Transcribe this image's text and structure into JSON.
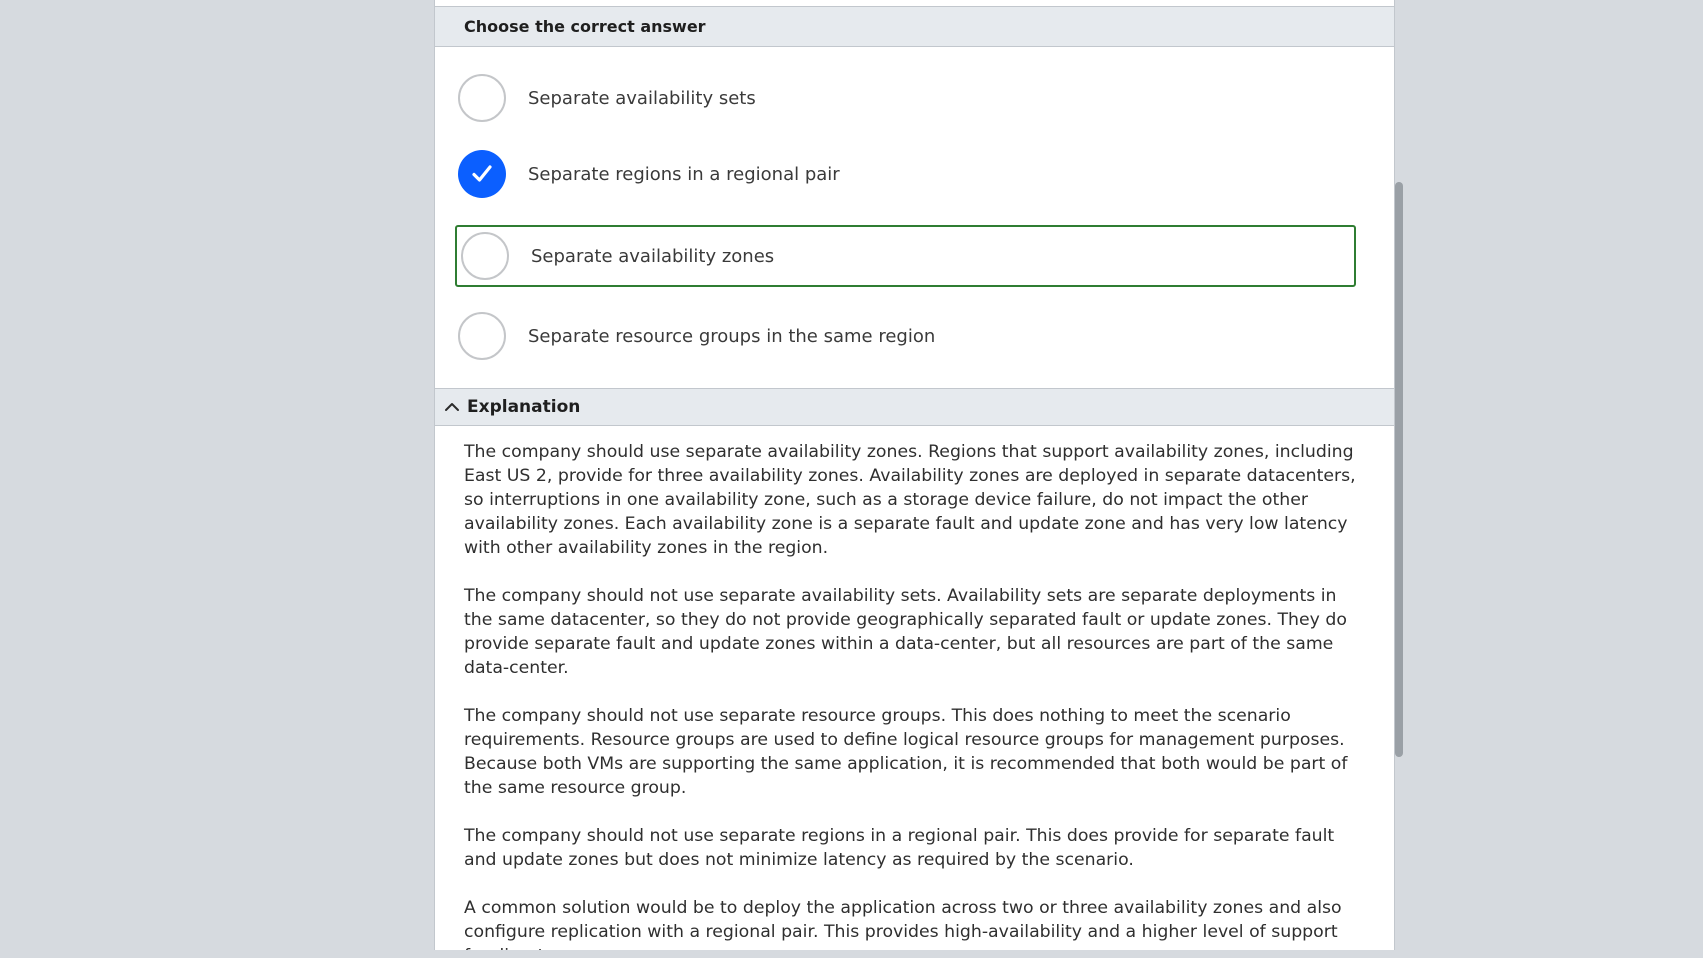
{
  "question": {
    "header": "Choose the correct answer",
    "options": [
      {
        "label": "Separate availability sets",
        "checked": false,
        "focused": false
      },
      {
        "label": "Separate regions in a regional pair",
        "checked": true,
        "focused": false
      },
      {
        "label": "Separate availability zones",
        "checked": false,
        "focused": true
      },
      {
        "label": "Separate resource groups in the same region",
        "checked": false,
        "focused": false
      }
    ]
  },
  "explanation": {
    "header": "Explanation",
    "paragraphs": [
      "The company should use separate availability zones. Regions that support availability zones, including East US 2, provide for three availability zones. Availability zones are deployed in separate datacenters, so interruptions in one availability zone, such as a storage device failure, do not impact the other availability zones. Each availability zone is a separate fault and update zone and has very low latency with other availability zones in the region.",
      "The company should not use separate availability sets. Availability sets are separate deployments in the same datacenter, so they do not provide geographically separated fault or update zones. They do provide separate fault and update zones within a data-center, but all resources are part of the same data-center.",
      "The company should not use separate resource groups. This does nothing to meet the scenario requirements. Resource groups are used to define logical resource groups for management purposes. Because both VMs are supporting the same application, it is recommended that both would be part of the same resource group.",
      "The company should not use separate regions in a regional pair. This does provide for separate fault and update zones but does not minimize latency as required by the scenario.",
      "A common solution would be to deploy the application across two or three availability zones and also configure replication with a regional pair. This provides high-availability and a higher level of support for disaster recovery."
    ]
  },
  "colors": {
    "background": "#d6dadf",
    "checked": "#0b5fff",
    "focus_border": "#2f7d32"
  },
  "icons": {
    "check": "checkmark-icon",
    "collapse": "chevron-up-icon"
  }
}
